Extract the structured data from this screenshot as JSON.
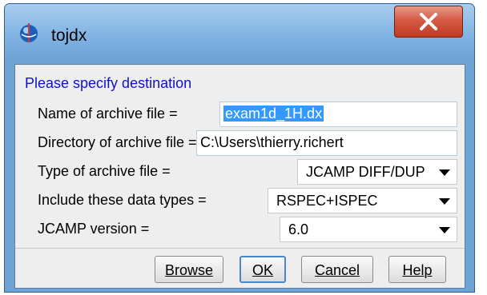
{
  "window": {
    "title": "tojdx",
    "close_label": "X"
  },
  "dialog": {
    "prompt": "Please specify destination",
    "fields": {
      "archive_name": {
        "label": "Name of archive file =",
        "value": "exam1d_1H.dx"
      },
      "archive_dir": {
        "label": "Directory of archive file =",
        "value": "C:\\Users\\thierry.richert"
      },
      "archive_type": {
        "label": "Type of archive file =",
        "value": "JCAMP DIFF/DUP"
      },
      "data_types": {
        "label": "Include these data types =",
        "value": "RSPEC+ISPEC"
      },
      "jcamp_version": {
        "label": "JCAMP version =",
        "value": "6.0"
      }
    },
    "buttons": {
      "browse": "Browse",
      "ok": "OK",
      "cancel": "Cancel",
      "help": "Help"
    }
  },
  "colors": {
    "accent": "#3399ff",
    "prompt_text": "#1010d0",
    "close_button": "#c9432b"
  }
}
